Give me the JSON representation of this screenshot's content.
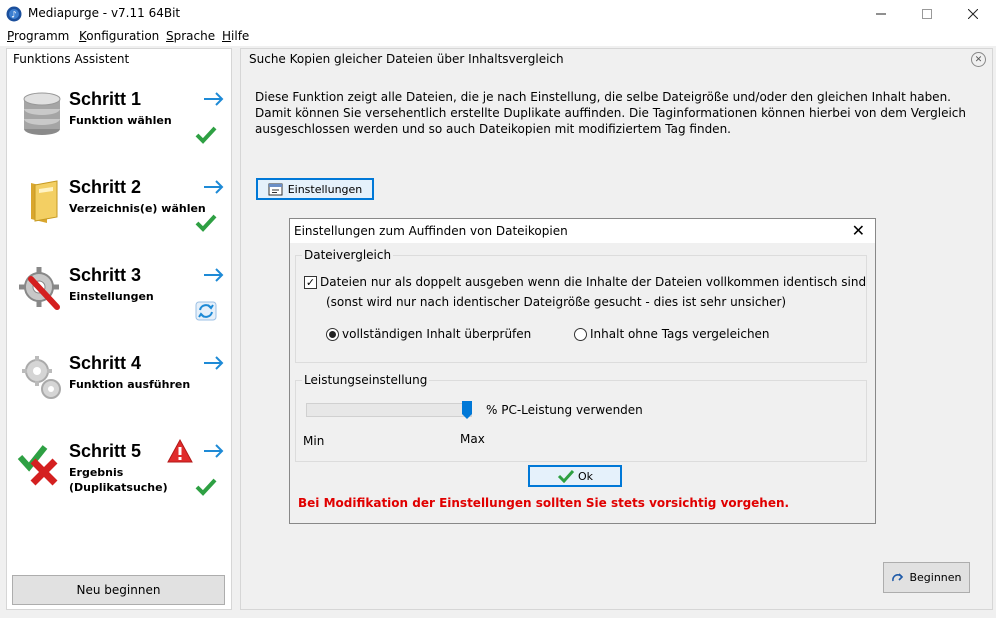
{
  "window": {
    "title": "Mediapurge - v7.11 64Bit"
  },
  "menu": {
    "items": [
      "Programm",
      "Konfiguration",
      "Sprache",
      "Hilfe"
    ]
  },
  "left_panel": {
    "title": "Funktions Assistent",
    "steps": [
      {
        "title": "Schritt 1",
        "subtitle": "Funktion wählen",
        "status": "done"
      },
      {
        "title": "Schritt 2",
        "subtitle": "Verzeichnis(e) wählen",
        "status": "done"
      },
      {
        "title": "Schritt 3",
        "subtitle": "Einstellungen",
        "status": "active"
      },
      {
        "title": "Schritt 4",
        "subtitle": "Funktion ausführen",
        "status": "none"
      },
      {
        "title": "Schritt 5",
        "subtitle_line1": "Ergebnis",
        "subtitle_line2": "(Duplikatsuche)",
        "status": "done"
      }
    ],
    "new_start_label": "Neu beginnen"
  },
  "main_panel": {
    "title": "Suche Kopien gleicher Dateien über Inhaltsvergleich",
    "description_lines": [
      "Diese Funktion zeigt alle Dateien, die je nach Einstellung, die selbe Dateigröße und/oder den gleichen Inhalt haben.",
      "Damit können Sie versehentlich erstellte Duplikate auffinden. Die Taginformationen können hierbei von dem Vergleich",
      "ausgeschlossen werden und so auch Dateikopien mit modifiziertem Tag finden."
    ],
    "settings_button_label": "Einstellungen",
    "begin_button_label": "Beginnen"
  },
  "dialog": {
    "title": "Einstellungen zum Auffinden von Dateikopien",
    "file_compare": {
      "group_label": "Dateivergleich",
      "checkbox_label": "Dateien nur als doppelt ausgeben wenn die Inhalte der Dateien vollkommen identisch sind",
      "checkbox_checked": true,
      "note": "(sonst wird nur nach identischer Dateigröße gesucht - dies ist sehr unsicher)",
      "radio_full": "vollständigen Inhalt überprüfen",
      "radio_no_tags": "Inhalt ohne Tags vergeleichen",
      "selected": "radio_full"
    },
    "performance": {
      "group_label": "Leistungseinstellung",
      "slider_label": "% PC-Leistung verwenden",
      "min_label": "Min",
      "max_label": "Max",
      "slider_value": 1.0
    },
    "ok_label": "Ok",
    "warning": "Bei Modifikation der Einstellungen sollten Sie stets vorsichtig vorgehen."
  },
  "colors": {
    "accent": "#0078d7",
    "check_green": "#2ea043",
    "warning_red": "#e00000",
    "arrow_blue": "#1e8ad6"
  }
}
